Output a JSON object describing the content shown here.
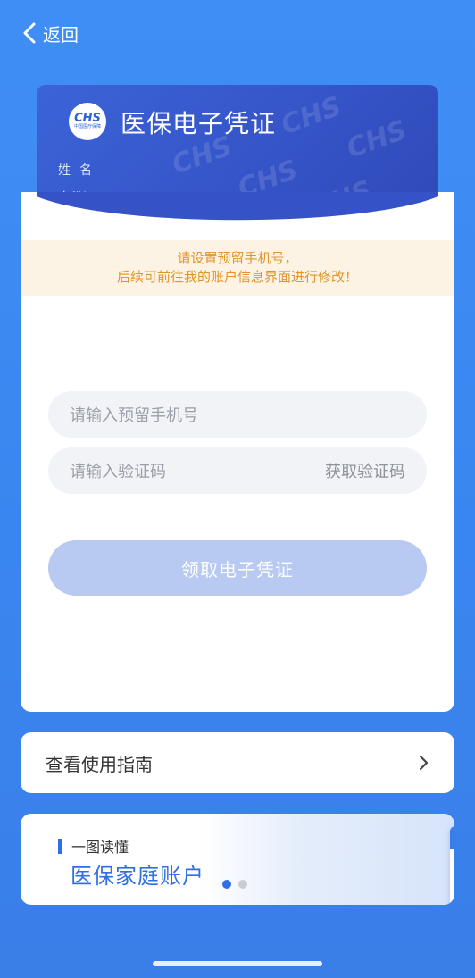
{
  "nav": {
    "back_label": "返回"
  },
  "card": {
    "logo_text": "CHS",
    "logo_subtext": "中国医疗保障",
    "title": "医保电子凭证",
    "name_label": "姓名",
    "id_label": "身份证"
  },
  "notice": {
    "line1": "请设置预留手机号，",
    "line2": "后续可前往我的账户信息界面进行修改！"
  },
  "form": {
    "phone_placeholder": "请输入预留手机号",
    "code_placeholder": "请输入验证码",
    "get_code_label": "获取验证码",
    "submit_label": "领取电子凭证"
  },
  "guide": {
    "label": "查看使用指南"
  },
  "banner": {
    "tag": "一图读懂",
    "title": "医保家庭账户",
    "carousel": {
      "count": 2,
      "active_index": 0
    }
  },
  "colors": {
    "background": "#3f8ef5",
    "card": "#3553c6",
    "accent": "#2f6fe6",
    "notice_text": "#e0952c",
    "notice_bg": "#fdf3e4",
    "button_disabled": "#b8c9f2"
  }
}
